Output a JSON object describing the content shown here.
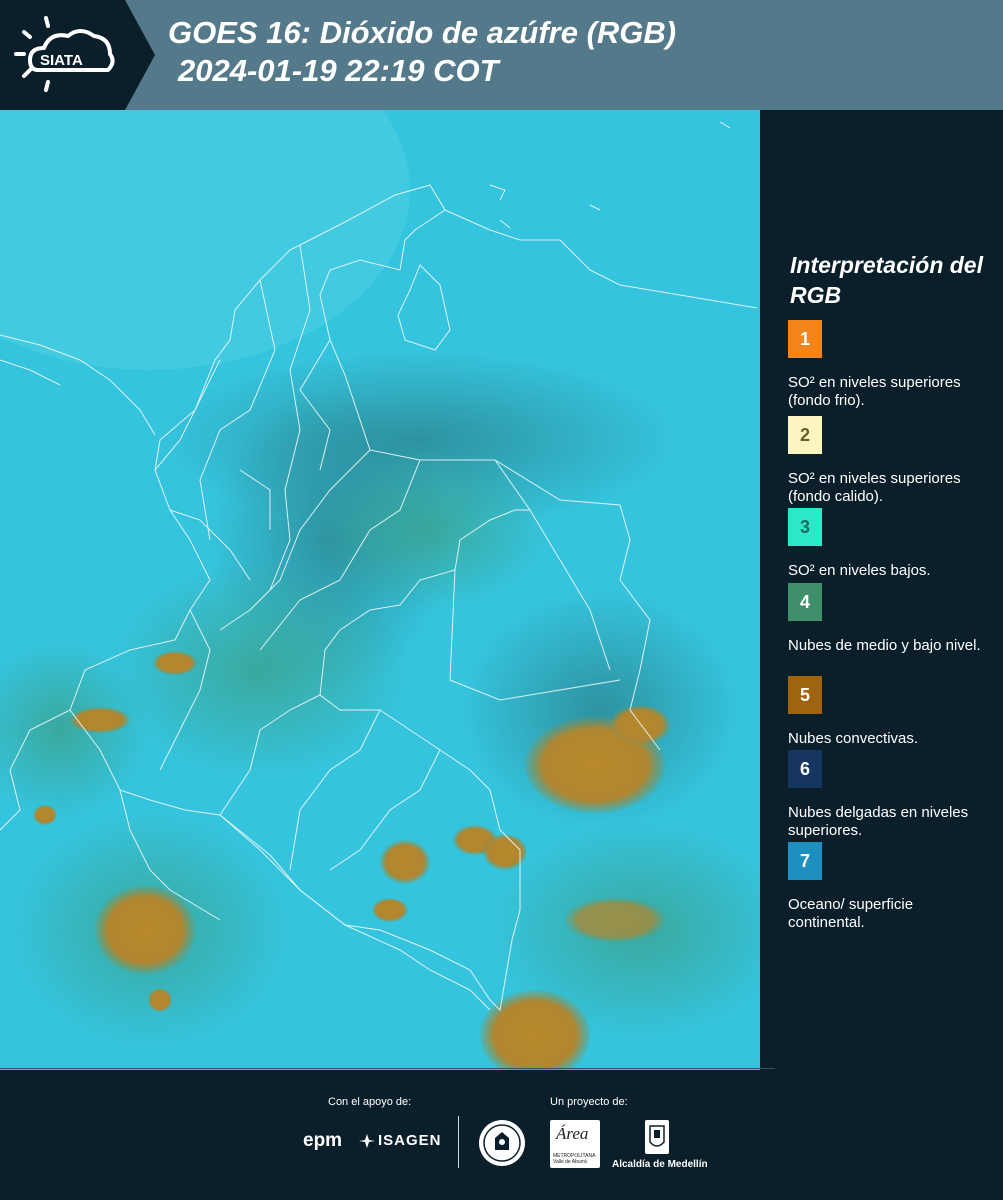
{
  "header": {
    "logo_text": "SIATA",
    "title_line1": "GOES 16: Dióxido de azúfre (RGB)",
    "title_line2": "2024-01-19 22:19 COT",
    "background_color": "#54798a"
  },
  "legend": {
    "title": "Interpretación del RGB",
    "items": [
      {
        "number": "1",
        "color": "#f28419",
        "label": "SO² en niveles superiores (fondo frio)."
      },
      {
        "number": "2",
        "color": "#fdf5c0",
        "label": "SO² en niveles superiores (fondo calido)."
      },
      {
        "number": "3",
        "color": "#2de8c8",
        "label": "SO² en niveles bajos."
      },
      {
        "number": "4",
        "color": "#3f8f6a",
        "label": "Nubes de medio y bajo nivel."
      },
      {
        "number": "5",
        "color": "#a06410",
        "label": "Nubes convectivas."
      },
      {
        "number": "6",
        "color": "#163560",
        "label": "Nubes delgadas en niveles superiores."
      },
      {
        "number": "7",
        "color": "#1f8fbf",
        "label": "Oceano/ superficie continental."
      }
    ]
  },
  "footer": {
    "support_label": "Con el apoyo de:",
    "project_label": "Un proyecto de:",
    "partner_epm": "epm",
    "partner_isagen": "ISAGEN",
    "area_name": "Área",
    "area_sub": "METROPOLITANA Valle de Aburrá",
    "alcaldia": "Alcaldía de Medellín"
  },
  "map": {
    "background_color": "#35c4dd",
    "convective_color": "#b8892c",
    "midlevel_color": "#3b9f88",
    "border_color": "#e6f4f7"
  }
}
